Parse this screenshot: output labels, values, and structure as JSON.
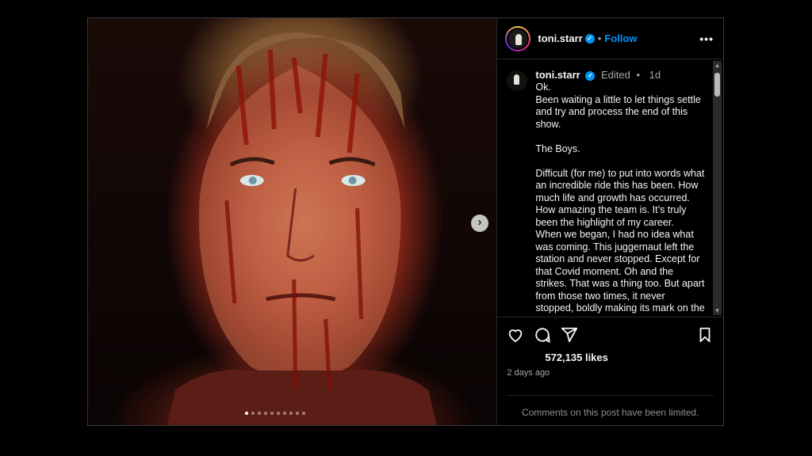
{
  "post": {
    "username": "toni.starr",
    "follow_label": "Follow",
    "separator": "•",
    "more_label": "•••",
    "edited_label": "Edited",
    "time_ago": "1d",
    "caption": "Ok.\nBeen waiting a little to let things settle and try and process the end of this show.\n\nThe Boys.\n\nDifficult (for me) to put into words what an incredible ride this has been. How much life and growth has occurred. How amazing the team is. It’s truly been the highlight of my career.\nWhen we began, I had no idea what was coming. This juggernaut left the station and never stopped. Except for that Covid moment. Oh and the strikes. That was a thing too. But apart from those two times, it never stopped, boldly making its mark on the",
    "likes": "572,135 likes",
    "posted": "2 days ago",
    "comments_limited": "Comments on this post have been limited."
  },
  "carousel": {
    "total_slides": 10,
    "current_slide": 1
  },
  "icons": [
    "heart-icon",
    "comment-icon",
    "share-icon",
    "bookmark-icon",
    "chevron-right-icon",
    "verified-icon",
    "more-icon"
  ],
  "colors": {
    "accent": "#0095f6",
    "background": "#000000",
    "border": "#262626",
    "muted": "#a8a8a8"
  }
}
